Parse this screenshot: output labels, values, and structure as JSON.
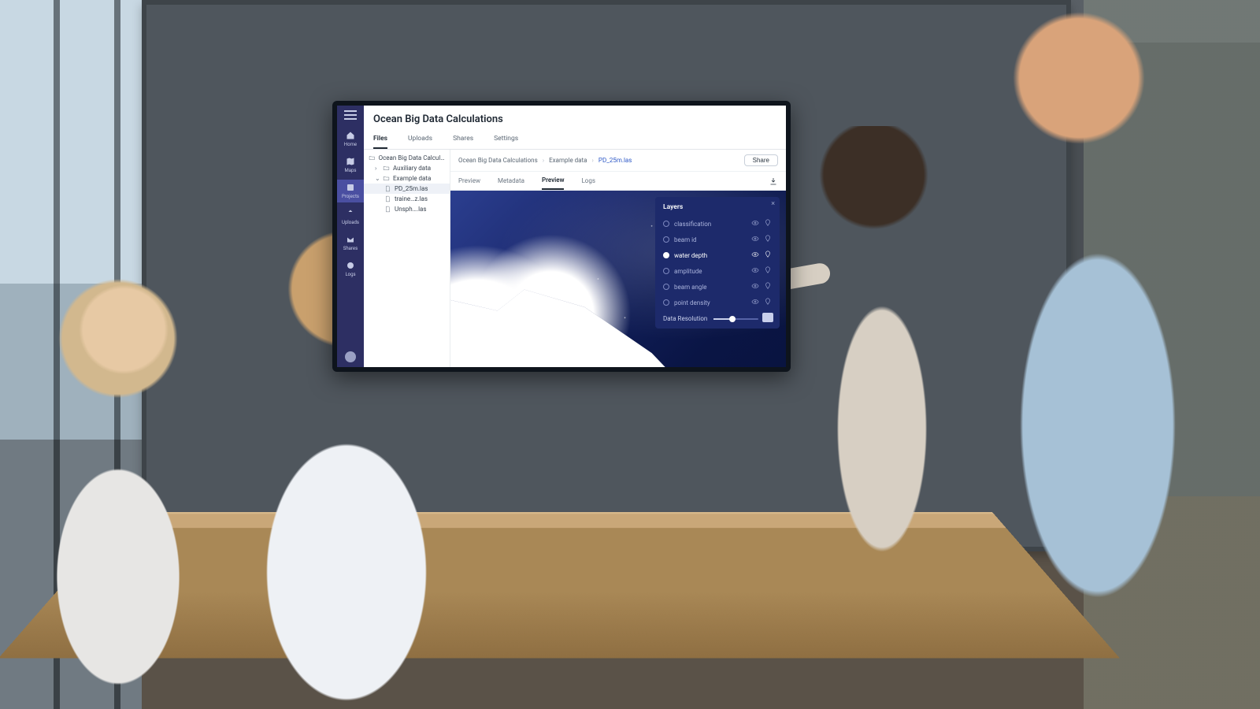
{
  "page_title": "Ocean Big Data Calculations",
  "navrail": {
    "items": [
      {
        "icon": "home",
        "label": "Home"
      },
      {
        "icon": "map",
        "label": "Maps"
      },
      {
        "icon": "projects",
        "label": "Projects",
        "active": true
      },
      {
        "icon": "upload",
        "label": "Uploads"
      },
      {
        "icon": "shares",
        "label": "Shares"
      },
      {
        "icon": "logs",
        "label": "Logs"
      }
    ]
  },
  "tabs": [
    "Files",
    "Uploads",
    "Shares",
    "Settings"
  ],
  "tabs_active": "Files",
  "file_tree": {
    "root_label": "Ocean Big Data Calcula…",
    "folders": [
      {
        "label": "Auxiliary data",
        "expanded": false
      },
      {
        "label": "Example data",
        "expanded": true,
        "children": [
          {
            "label": "PD_25m.las",
            "selected": true
          },
          {
            "label": "traine…z.las"
          },
          {
            "label": "Unsph….las"
          }
        ]
      }
    ]
  },
  "breadcrumb": [
    "Ocean Big Data Calculations",
    "Example data",
    "PD_25m.las"
  ],
  "share_label": "Share",
  "subtabs": [
    "Preview",
    "Metadata",
    "Preview",
    "Logs"
  ],
  "subtabs_active_index": 2,
  "layers_panel": {
    "title": "Layers",
    "items": [
      {
        "label": "classification"
      },
      {
        "label": "beam id"
      },
      {
        "label": "water depth",
        "active": true
      },
      {
        "label": "amplitude"
      },
      {
        "label": "beam angle"
      },
      {
        "label": "point density"
      }
    ],
    "resolution_label": "Data Resolution",
    "resolution_value": "15"
  }
}
